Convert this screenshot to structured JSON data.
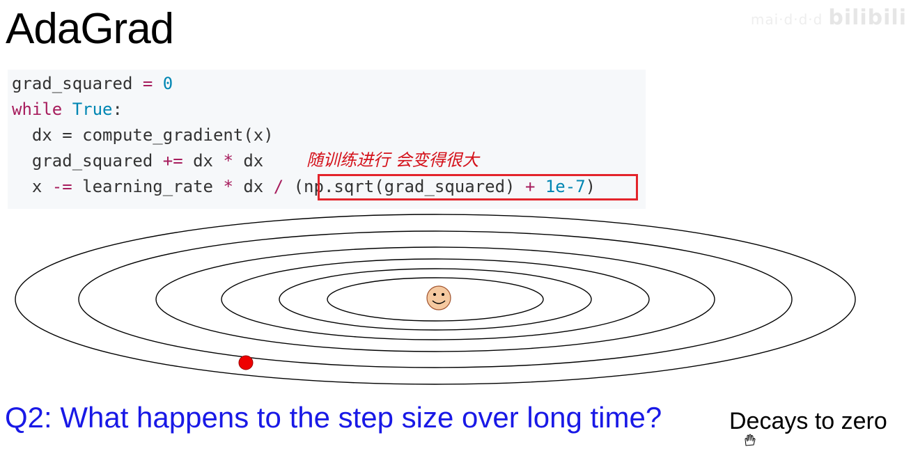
{
  "slide": {
    "title": "AdaGrad",
    "watermark": "bilibili",
    "watermark_faint": "mai·d·d·d"
  },
  "code": {
    "line1": {
      "var": "grad_squared",
      "op": " = ",
      "num": "0"
    },
    "line2": {
      "kw": "while",
      "sp": " ",
      "bi": "True",
      "rest": ":"
    },
    "line3": {
      "text": "  dx = compute_gradient(x)"
    },
    "line4": {
      "a": "  grad_squared ",
      "op1": "+=",
      "b": " dx ",
      "op2": "*",
      "c": " dx"
    },
    "line5": {
      "a": "  x ",
      "op1": "-=",
      "b": " learning_rate ",
      "op2": "*",
      "c": " dx ",
      "op3": "/",
      "d": " (np.sqrt(grad_squared) ",
      "op4": "+",
      "e": " ",
      "num": "1e-7",
      "f": ")"
    }
  },
  "annotation": {
    "text": "随训练进行 会变得很大",
    "color": "#d4111a"
  },
  "highlight": {
    "color": "#e3242b"
  },
  "contour_plot": {
    "contour_count": 6,
    "minimum_marker": "smiley-face-icon",
    "current_point_marker": "red-dot",
    "point_color": "#ee0000",
    "smiley_color": "#f5c9a0"
  },
  "question": {
    "text": "Q2: What happens to the step size over long time?",
    "color": "#1919e6"
  },
  "answer": {
    "text": "Decays to zero"
  }
}
